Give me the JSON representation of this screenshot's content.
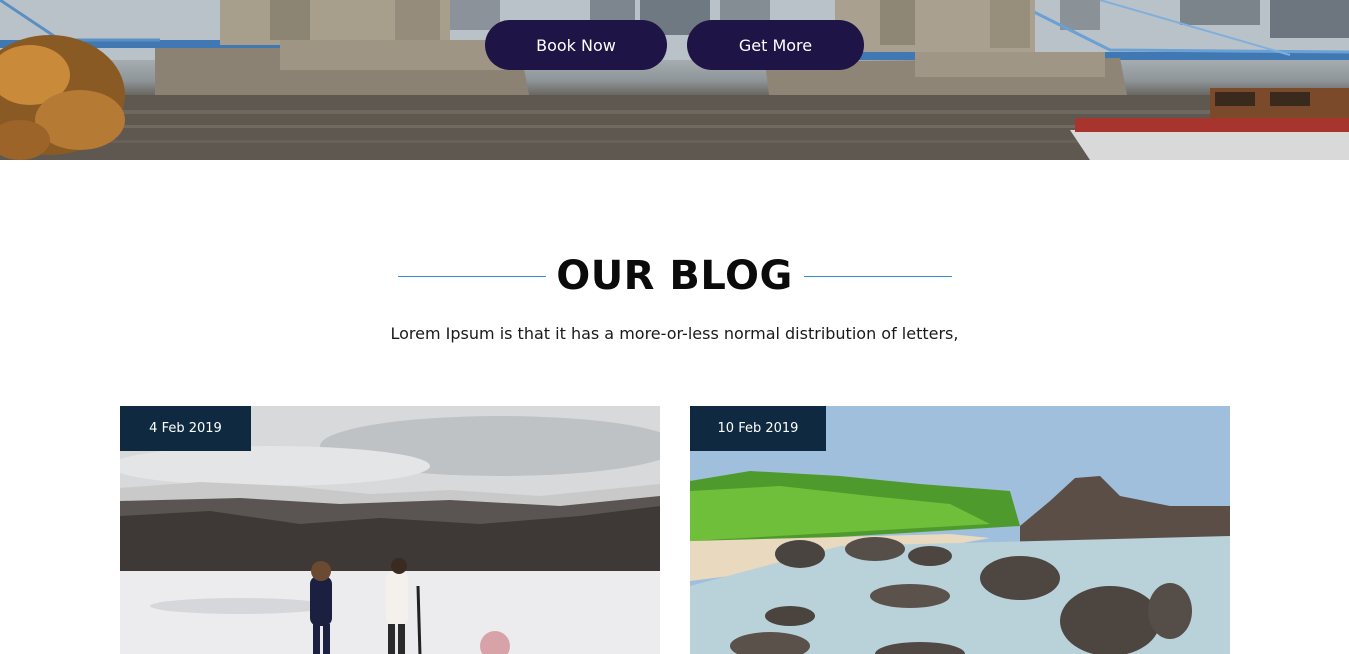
{
  "hero": {
    "buttons": {
      "book_now": "Book Now",
      "get_more": "Get More"
    },
    "button_color": "#1e1446"
  },
  "blog": {
    "title": "OUR BLOG",
    "subtitle": "Lorem Ipsum is that it has a more-or-less normal distribution of letters,",
    "accent_line_color": "#2f8fd0",
    "posts": [
      {
        "date": "4 Feb 2019"
      },
      {
        "date": "10 Feb 2019"
      }
    ],
    "badge_color": "#0f2a40"
  }
}
